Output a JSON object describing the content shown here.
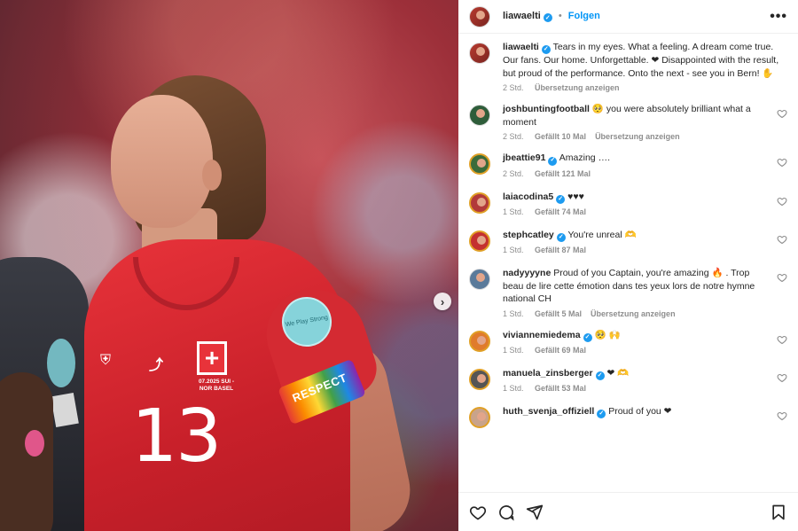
{
  "post": {
    "author": "liawaelti",
    "follow_label": "Folgen",
    "separator": "•",
    "more_label": "•••",
    "next_label": "›",
    "image": {
      "armband_text": "RESPECT",
      "patch_text": "We Play Strong",
      "match_text": "07.2025 SUI - NOR BASEL",
      "shirt_number": "13"
    }
  },
  "caption": {
    "username": "liawaelti",
    "text": "Tears in my eyes. What a feeling. A dream come true. Our fans. Our home. Unforgettable. ❤ Disappointed with the result, but proud of the performance. Onto the next - see you in Bern! ✋",
    "time": "2 Std.",
    "translate": "Übersetzung anzeigen"
  },
  "comments": [
    {
      "username": "joshbuntingfootball",
      "verified": false,
      "text": "🥺 you were absolutely brilliant what a moment",
      "time": "2 Std.",
      "likes": "Gefällt 10 Mal",
      "translate": "Übersetzung anzeigen",
      "avatar_color": "#2e5d3a",
      "ring": false
    },
    {
      "username": "jbeattie91",
      "verified": true,
      "text": "Amazing ….",
      "time": "2 Std.",
      "likes": "Gefällt 121 Mal",
      "translate": "",
      "avatar_color": "#3b6b3a",
      "ring": true
    },
    {
      "username": "laiacodina5",
      "verified": true,
      "text": "♥♥♥",
      "time": "1 Std.",
      "likes": "Gefällt 74 Mal",
      "translate": "",
      "avatar_color": "#b23a3a",
      "ring": true
    },
    {
      "username": "stephcatley",
      "verified": true,
      "text": "You're unreal 🫶",
      "time": "1 Std.",
      "likes": "Gefällt 87 Mal",
      "translate": "",
      "avatar_color": "#c43030",
      "ring": true
    },
    {
      "username": "nadyyyyne",
      "verified": false,
      "text": "Proud of you Captain, you're amazing 🔥 . Trop beau de lire cette émotion dans tes yeux lors de notre hymne national CH",
      "time": "1 Std.",
      "likes": "Gefällt 5 Mal",
      "translate": "Übersetzung anzeigen",
      "avatar_color": "#5a7a9a",
      "ring": false
    },
    {
      "username": "viviannemiedema",
      "verified": true,
      "text": "🥺 🙌",
      "time": "1 Std.",
      "likes": "Gefällt 69 Mal",
      "translate": "",
      "avatar_color": "#e07b2c",
      "ring": true
    },
    {
      "username": "manuela_zinsberger",
      "verified": true,
      "text": "❤ 🫶",
      "time": "1 Std.",
      "likes": "Gefällt 53 Mal",
      "translate": "",
      "avatar_color": "#555555",
      "ring": true
    },
    {
      "username": "huth_svenja_offiziell",
      "verified": true,
      "text": "Proud of you ❤",
      "time": "",
      "likes": "",
      "translate": "",
      "avatar_color": "#c9a38a",
      "ring": true
    }
  ],
  "icons": {
    "like": "heart-outline-icon",
    "comment": "comment-icon",
    "share": "paper-plane-icon",
    "save": "bookmark-icon"
  }
}
